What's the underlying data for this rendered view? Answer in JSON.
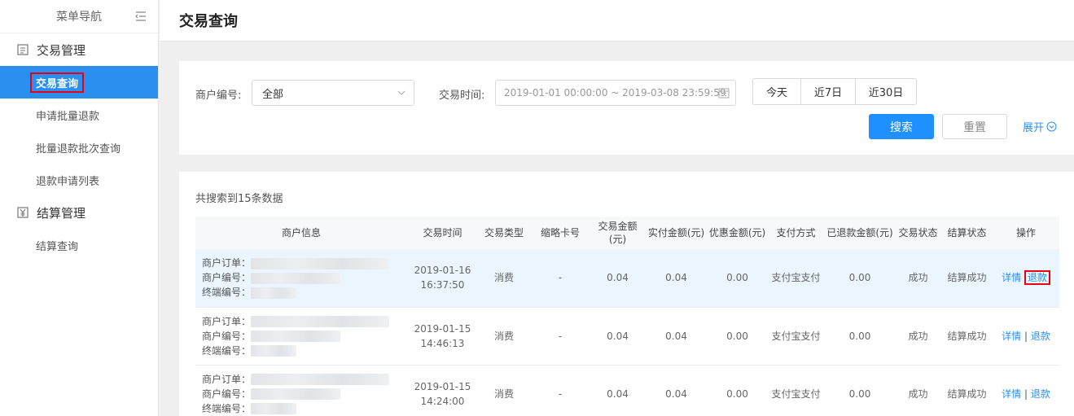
{
  "sidebar": {
    "header": "菜单导航",
    "groups": [
      {
        "label": "交易管理",
        "items": [
          "交易查询",
          "申请批量退款",
          "批量退款批次查询",
          "退款申请列表"
        ]
      },
      {
        "label": "结算管理",
        "items": [
          "结算查询"
        ]
      }
    ]
  },
  "topbar": {
    "title": "交易查询"
  },
  "filter": {
    "merchant_label": "商户编号:",
    "merchant_value": "全部",
    "time_label": "交易时间:",
    "time_range": "2019-01-01 00:00:00 ~ 2019-03-08 23:59:59",
    "quick": [
      "今天",
      "近7日",
      "近30日"
    ],
    "search": "搜索",
    "reset": "重置",
    "expand": "展开"
  },
  "results": {
    "count_text": "共搜索到15条数据",
    "headers": [
      "商户信息",
      "交易时间",
      "交易类型",
      "缩略卡号",
      "交易金额(元)",
      "实付金额(元)",
      "优惠金额(元)",
      "支付方式",
      "已退款金额(元)",
      "交易状态",
      "结算状态",
      "操作"
    ],
    "merchant_labels": [
      "商户订单：",
      "商户编号：",
      "终端编号："
    ],
    "rows": [
      {
        "time": "2019-01-16 16:37:50",
        "type": "消费",
        "card": "-",
        "amount": "0.04",
        "paid": "0.04",
        "discount": "0.00",
        "method": "支付宝支付",
        "refunded": "0.00",
        "status": "成功",
        "settle": "结算成功",
        "detail": "详情",
        "refund": "退款"
      },
      {
        "time": "2019-01-15 14:46:13",
        "type": "消费",
        "card": "-",
        "amount": "0.04",
        "paid": "0.04",
        "discount": "0.00",
        "method": "支付宝支付",
        "refunded": "0.00",
        "status": "成功",
        "settle": "结算成功",
        "detail": "详情",
        "refund": "退款"
      },
      {
        "time": "2019-01-15 14:24:00",
        "type": "消费",
        "card": "-",
        "amount": "0.04",
        "paid": "0.04",
        "discount": "0.00",
        "method": "支付宝支付",
        "refunded": "0.00",
        "status": "成功",
        "settle": "结算成功",
        "detail": "详情",
        "refund": "退款"
      }
    ]
  },
  "colors": {
    "accent": "#2b8ff0",
    "primary_button": "#1e90ff",
    "highlight_box": "#e60012",
    "row_highlight": "#eaf5fd"
  }
}
